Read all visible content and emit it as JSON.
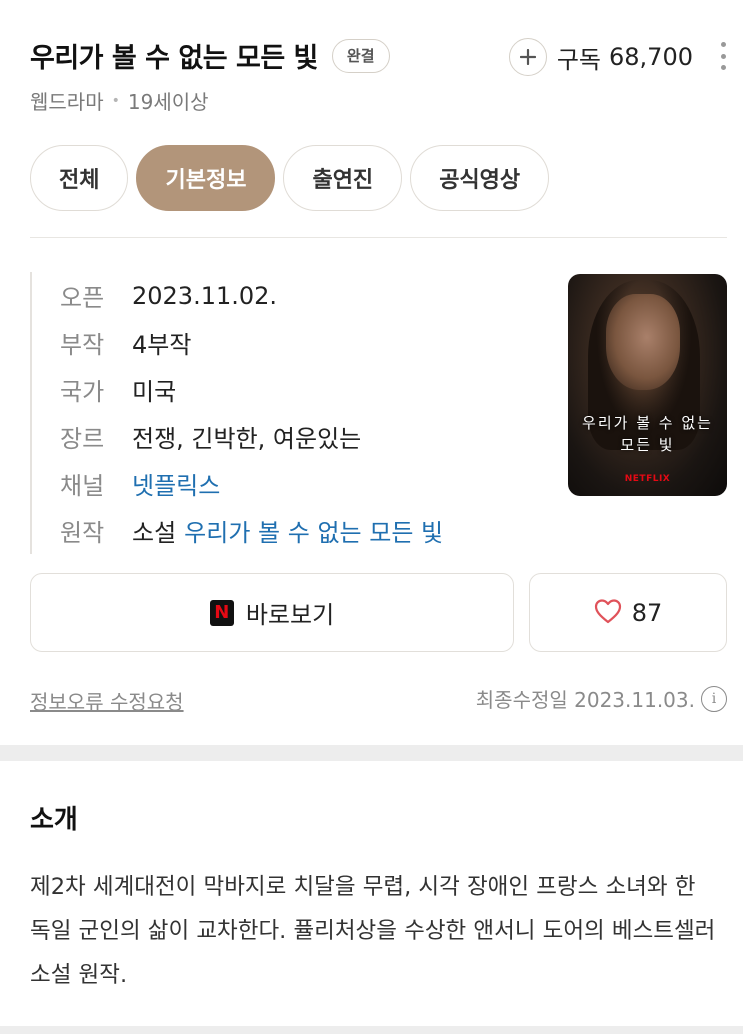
{
  "header": {
    "title": "우리가 볼 수 없는 모든 빛",
    "status_badge": "완결",
    "subscribe_label": "구독",
    "subscribe_count": "68,700",
    "category": "웹드라마",
    "age_rating": "19세이상"
  },
  "tabs": [
    {
      "label": "전체",
      "active": false
    },
    {
      "label": "기본정보",
      "active": true
    },
    {
      "label": "출연진",
      "active": false
    },
    {
      "label": "공식영상",
      "active": false
    }
  ],
  "info": {
    "open_label": "오픈",
    "open_value": "2023.11.02.",
    "episodes_label": "부작",
    "episodes_value": "4부작",
    "country_label": "국가",
    "country_value": "미국",
    "genre_label": "장르",
    "genre_value": "전쟁, 긴박한, 여운있는",
    "channel_label": "채널",
    "channel_value": "넷플릭스",
    "original_label": "원작",
    "original_type": "소설",
    "original_value": "우리가 볼 수 없는 모든 빛"
  },
  "poster": {
    "title_line1": "우리가 볼 수 없는",
    "title_line2": "모든 빛",
    "logo": "NETFLIX"
  },
  "actions": {
    "watch_label": "바로보기",
    "like_count": "87"
  },
  "footer": {
    "report_label": "정보오류 수정요청",
    "modified_label": "최종수정일 2023.11.03."
  },
  "intro": {
    "title": "소개",
    "body": "제2차 세계대전이 막바지로 치달을 무렵, 시각 장애인 프랑스 소녀와 한 독일 군인의 삶이 교차한다. 퓰리처상을 수상한 앤서니 도어의 베스트셀러 소설 원작."
  },
  "colors": {
    "accent_tab": "#b2957a",
    "link": "#1f6fb0",
    "heart": "#e0525a",
    "netflix_red": "#e50914"
  },
  "icons": [
    "plus-icon",
    "kebab-menu-icon",
    "netflix-logo-icon",
    "heart-icon",
    "info-icon"
  ]
}
